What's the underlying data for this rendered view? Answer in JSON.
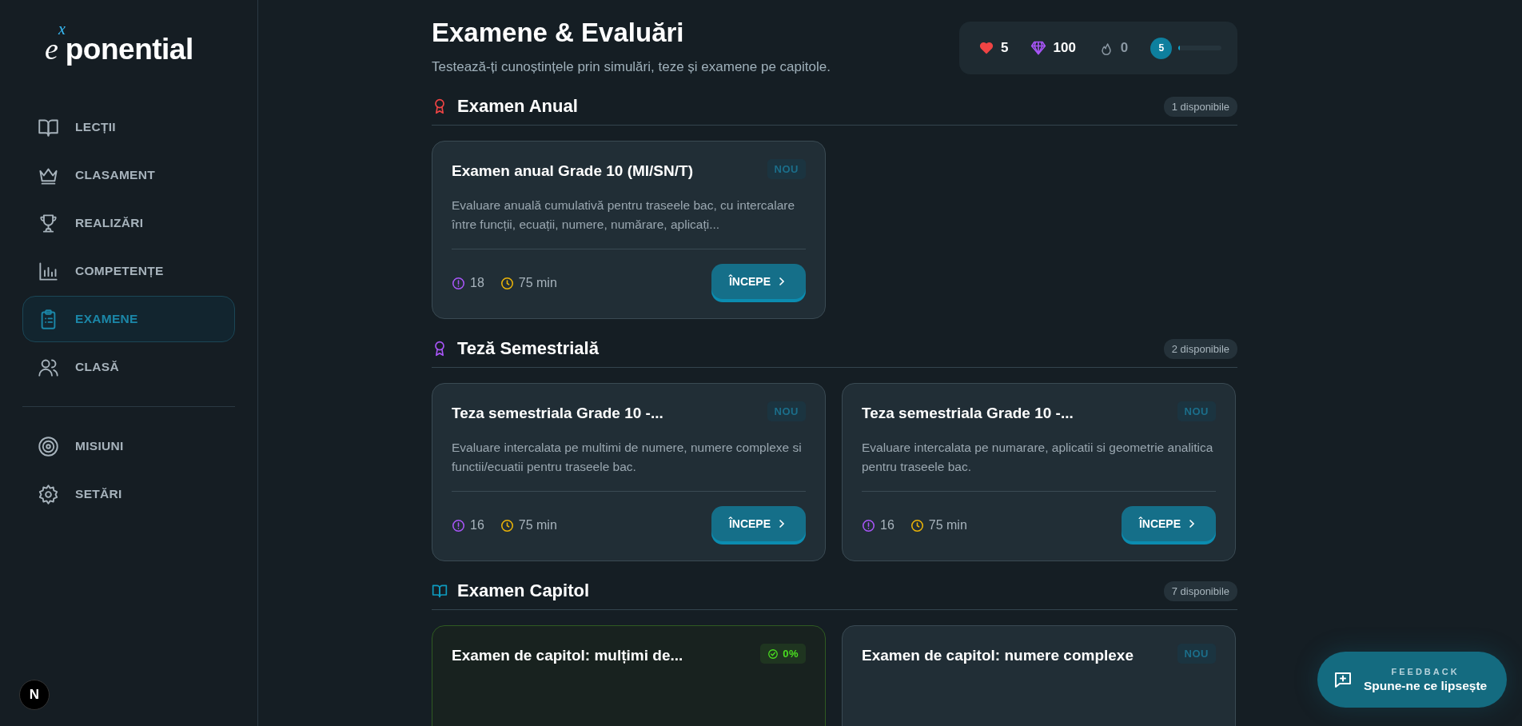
{
  "logo": {
    "base": "e",
    "exponent": "x",
    "rest": "ponential"
  },
  "sidebar": {
    "items": [
      {
        "label": "LECȚII",
        "kind": "book",
        "selected": false
      },
      {
        "label": "CLASAMENT",
        "kind": "crown",
        "selected": false
      },
      {
        "label": "REALIZĂRI",
        "kind": "trophy",
        "selected": false
      },
      {
        "label": "COMPETENȚE",
        "kind": "chart",
        "selected": false
      },
      {
        "label": "EXAMENE",
        "kind": "clipboard",
        "selected": true
      },
      {
        "label": "CLASĂ",
        "kind": "users",
        "selected": false
      }
    ],
    "secondary_items": [
      {
        "label": "MISIUNI",
        "kind": "target",
        "selected": false
      },
      {
        "label": "SETĂRI",
        "kind": "gear",
        "selected": false
      }
    ],
    "dev_badge": "N"
  },
  "header": {
    "title": "Examene & Evaluări",
    "subtitle": "Testează-ți cunoștințele prin simulări, teze și examene pe capitole."
  },
  "stats": {
    "hearts": "5",
    "gems": "100",
    "streak": "0",
    "xp_level": "5",
    "level": 0.03
  },
  "sections": [
    {
      "title": "Examen Anual",
      "kind": "award",
      "color": "#ef4444",
      "count": "1 disponibile",
      "cards": [
        {
          "title": "Examen anual Grade 10 (MI/SN/T)",
          "badge": {
            "kind": "new",
            "text": "NOU"
          },
          "description": "Evaluare anuală cumulativă pentru traseele bac, cu intercalare între funcții, ecuații, numere, numărare, aplicați...",
          "questions": "18",
          "duration": "75 min",
          "button": "ÎNCEPE"
        }
      ]
    },
    {
      "title": "Teză Semestrială",
      "kind": "award",
      "color": "#a855f7",
      "count": "2 disponibile",
      "cards": [
        {
          "title": "Teza semestriala Grade 10 -...",
          "badge": {
            "kind": "new",
            "text": "NOU"
          },
          "description": "Evaluare intercalata pe multimi de numere, numere complexe si functii/ecuatii pentru traseele bac.",
          "questions": "16",
          "duration": "75 min",
          "button": "ÎNCEPE"
        },
        {
          "title": "Teza semestriala Grade 10 -...",
          "badge": {
            "kind": "new",
            "text": "NOU"
          },
          "description": "Evaluare intercalata pe numarare, aplicatii si geometrie analitica pentru traseele bac.",
          "questions": "16",
          "duration": "75 min",
          "button": "ÎNCEPE"
        }
      ]
    },
    {
      "title": "Examen Capitol",
      "kind": "book",
      "color": "#0e9bbf",
      "count": "7 disponibile",
      "cards": [
        {
          "title": "Examen de capitol: mulțimi de...",
          "badge": {
            "kind": "progress",
            "text": "0%"
          }
        },
        {
          "title": "Examen de capitol: numere complexe",
          "badge": {
            "kind": "new",
            "text": "NOU"
          }
        }
      ]
    }
  ],
  "feedback": {
    "label": "FEEDBACK",
    "text": "Spune-ne ce lipsește"
  }
}
